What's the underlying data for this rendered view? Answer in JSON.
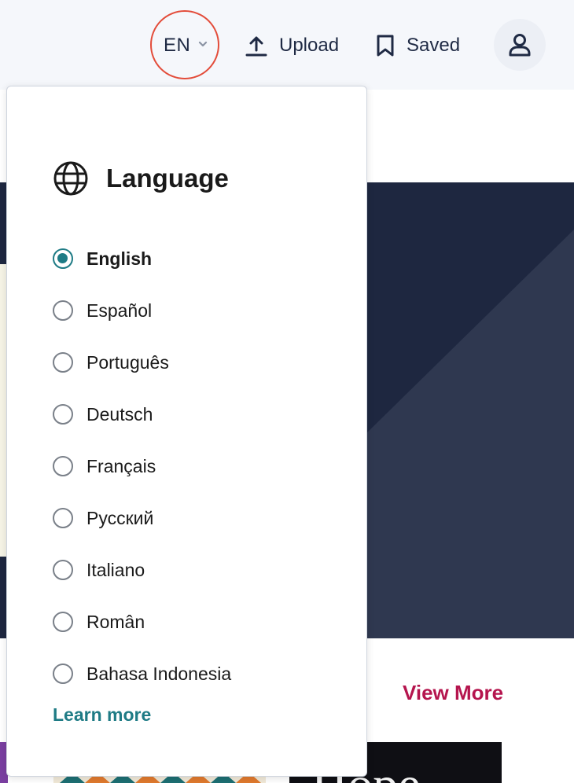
{
  "header": {
    "language_code": "EN",
    "upload_label": "Upload",
    "saved_label": "Saved"
  },
  "main": {
    "view_more_label": "View More",
    "book_cover_text": "Hope"
  },
  "language_menu": {
    "title": "Language",
    "selected": "English",
    "options": [
      {
        "label": "English",
        "checked": true
      },
      {
        "label": "Español",
        "checked": false
      },
      {
        "label": "Português",
        "checked": false
      },
      {
        "label": "Deutsch",
        "checked": false
      },
      {
        "label": "Français",
        "checked": false
      },
      {
        "label": "Русский",
        "checked": false
      },
      {
        "label": "Italiano",
        "checked": false
      },
      {
        "label": "Român",
        "checked": false
      },
      {
        "label": "Bahasa Indonesia",
        "checked": false
      }
    ],
    "learn_more_label": "Learn more"
  },
  "colors": {
    "accent_teal": "#1e7b85",
    "highlight_circle": "#e34c3a",
    "view_more": "#b5154e",
    "hero_dark": "#1e2740"
  },
  "icons": {
    "language_chevron": "chevron-down-icon",
    "upload": "upload-icon",
    "saved": "bookmark-icon",
    "account": "user-icon",
    "menu_title": "globe-icon",
    "carousel": "chevron-right-icon"
  }
}
